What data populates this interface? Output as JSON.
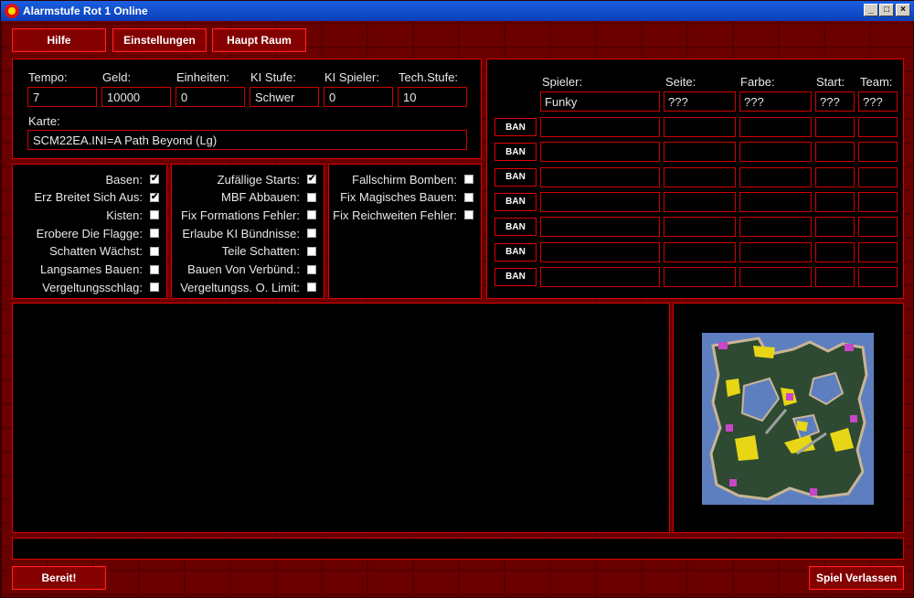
{
  "window": {
    "title": "Alarmstufe Rot 1 Online"
  },
  "toolbar": {
    "help": "Hilfe",
    "settings": "Einstellungen",
    "main_room": "Haupt Raum"
  },
  "settings": {
    "fields": [
      {
        "label": "Tempo:",
        "value": "7"
      },
      {
        "label": "Geld:",
        "value": "10000"
      },
      {
        "label": "Einheiten:",
        "value": "0"
      },
      {
        "label": "KI Stufe:",
        "value": "Schwer"
      },
      {
        "label": "KI Spieler:",
        "value": "0"
      },
      {
        "label": "Tech.Stufe:",
        "value": "10"
      }
    ],
    "map_label": "Karte:",
    "map_value": "SCM22EA.INI=A Path Beyond (Lg)"
  },
  "options_col1": [
    {
      "label": "Basen:",
      "checked": true
    },
    {
      "label": "Erz Breitet Sich Aus:",
      "checked": true
    },
    {
      "label": "Kisten:",
      "checked": false
    },
    {
      "label": "Erobere Die Flagge:",
      "checked": false
    },
    {
      "label": "Schatten Wächst:",
      "checked": false
    },
    {
      "label": "Langsames Bauen:",
      "checked": false
    },
    {
      "label": "Vergeltungsschlag:",
      "checked": false
    }
  ],
  "options_col2": [
    {
      "label": "Zufällige Starts:",
      "checked": true
    },
    {
      "label": "MBF Abbauen:",
      "checked": false
    },
    {
      "label": "Fix Formations Fehler:",
      "checked": false
    },
    {
      "label": "Erlaube KI Bündnisse:",
      "checked": false
    },
    {
      "label": "Teile Schatten:",
      "checked": false
    },
    {
      "label": "Bauen Von Verbünd.:",
      "checked": false
    },
    {
      "label": "Vergeltungss. O. Limit:",
      "checked": false
    }
  ],
  "options_col3": [
    {
      "label": "Fallschirm Bomben:",
      "checked": false
    },
    {
      "label": "Fix Magisches Bauen:",
      "checked": false
    },
    {
      "label": "Fix Reichweiten Fehler:",
      "checked": false
    }
  ],
  "players": {
    "headers": {
      "player": "Spieler:",
      "side": "Seite:",
      "color": "Farbe:",
      "start": "Start:",
      "team": "Team:"
    },
    "host": {
      "player": "Funky",
      "side": "???",
      "color": "???",
      "start": "???",
      "team": "???"
    },
    "ban_label": "BAN",
    "slot_count": 7
  },
  "bottom": {
    "ready": "Bereit!",
    "leave": "Spiel Verlassen"
  },
  "colors": {
    "frame": "#e00000",
    "background": "#6a0000",
    "panel": "#000000"
  }
}
